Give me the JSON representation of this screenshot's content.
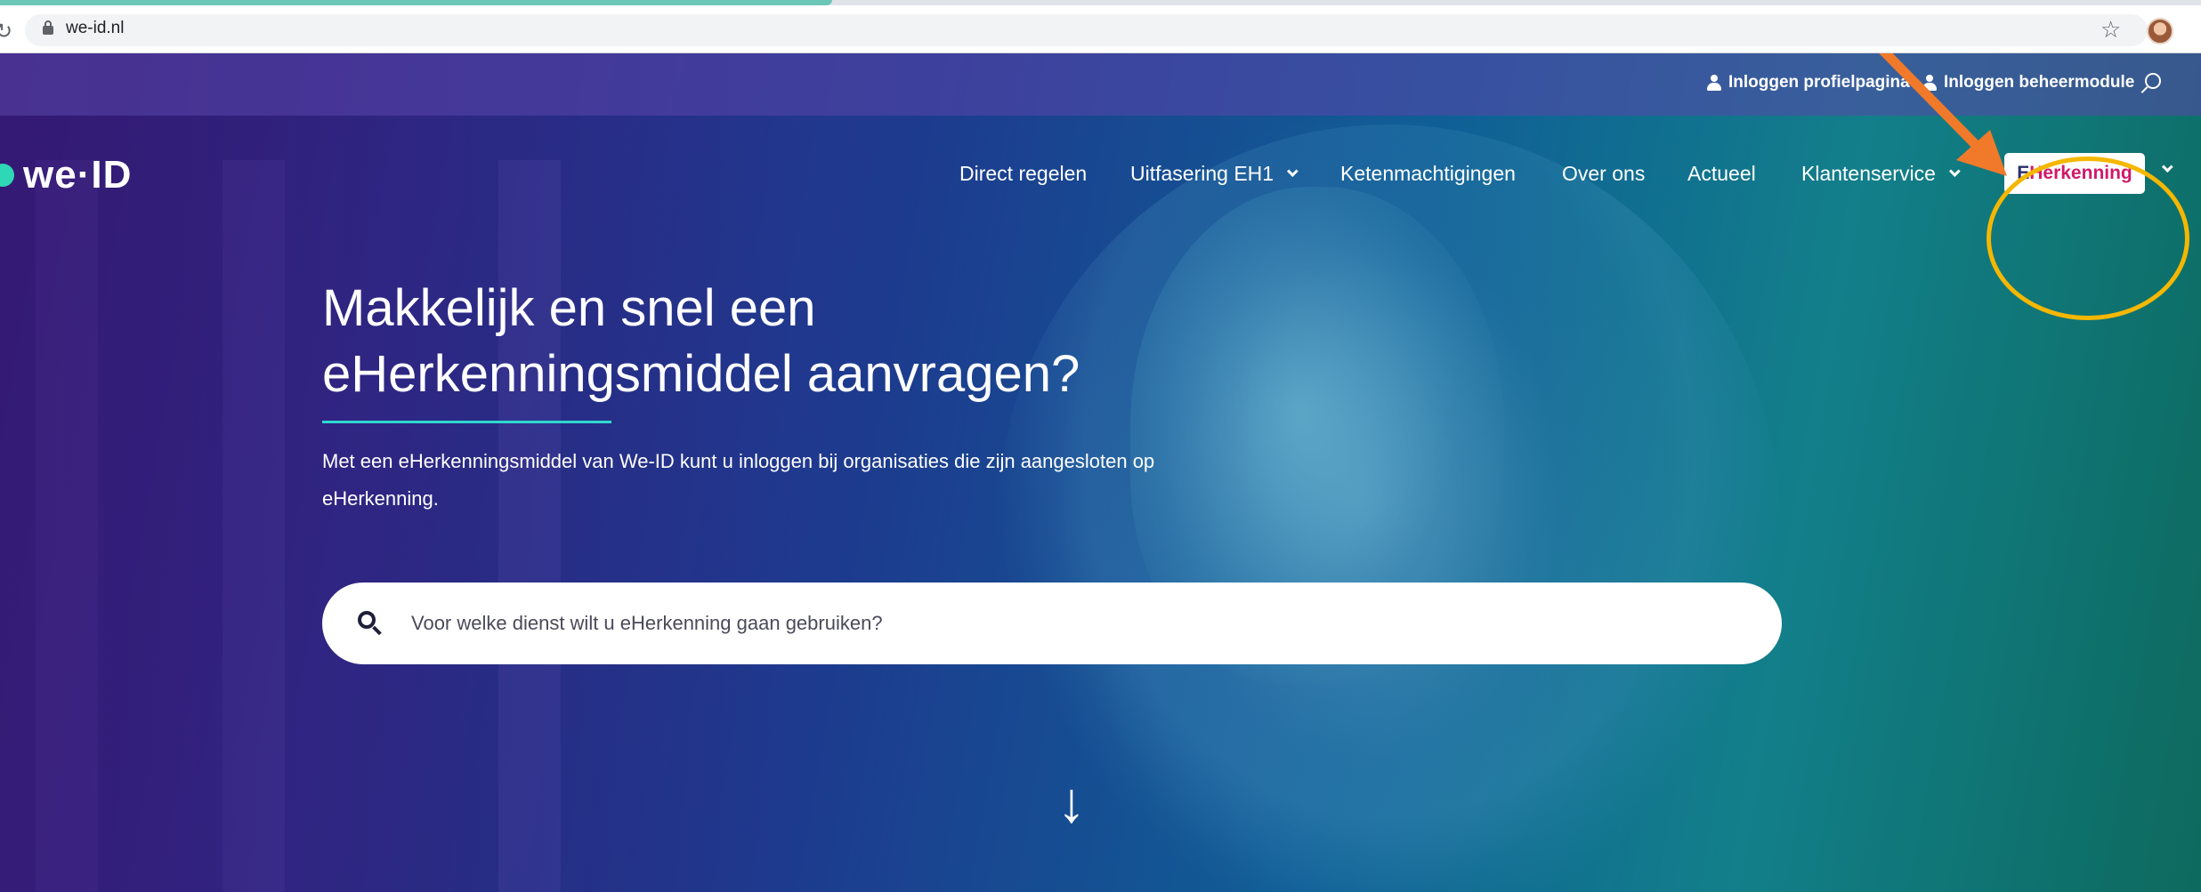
{
  "browser": {
    "url": "we-id.nl",
    "icons": {
      "reload": "reload-icon",
      "lock": "lock-icon",
      "bookmark": "star-icon",
      "profile": "avatar"
    }
  },
  "utility": {
    "login_profile": "Inloggen profielpagina",
    "login_admin": "Inloggen beheermodule",
    "search_icon": "search-icon"
  },
  "logo": {
    "text": "we·ID"
  },
  "nav": {
    "items": [
      {
        "label": "Direct regelen",
        "dropdown": false
      },
      {
        "label": "Uitfasering EH1",
        "dropdown": true
      },
      {
        "label": "Ketenmachtigingen",
        "dropdown": false
      },
      {
        "label": "Over ons",
        "dropdown": false
      },
      {
        "label": "Actueel",
        "dropdown": false
      },
      {
        "label": "Klantenservice",
        "dropdown": true
      }
    ],
    "eherkenning": {
      "prefix": "E",
      "rest": "Herkenning"
    }
  },
  "hero": {
    "headline_line1": "Makkelijk en snel een",
    "headline_line2": "eHerkenningsmiddel aanvragen?",
    "intro": "Met een eHerkenningsmiddel van We-ID kunt u inloggen bij organisaties die zijn aangesloten op eHerkenning.",
    "search_placeholder": "Voor welke dienst wilt u eHerkenning gaan gebruiken?",
    "scroll_arrow": "↓"
  },
  "colors": {
    "accent_teal": "#2ed8b6",
    "eherkenning_pink": "#d0196a",
    "annotation_circle": "#f5b700",
    "annotation_arrow": "#f07a2a"
  }
}
